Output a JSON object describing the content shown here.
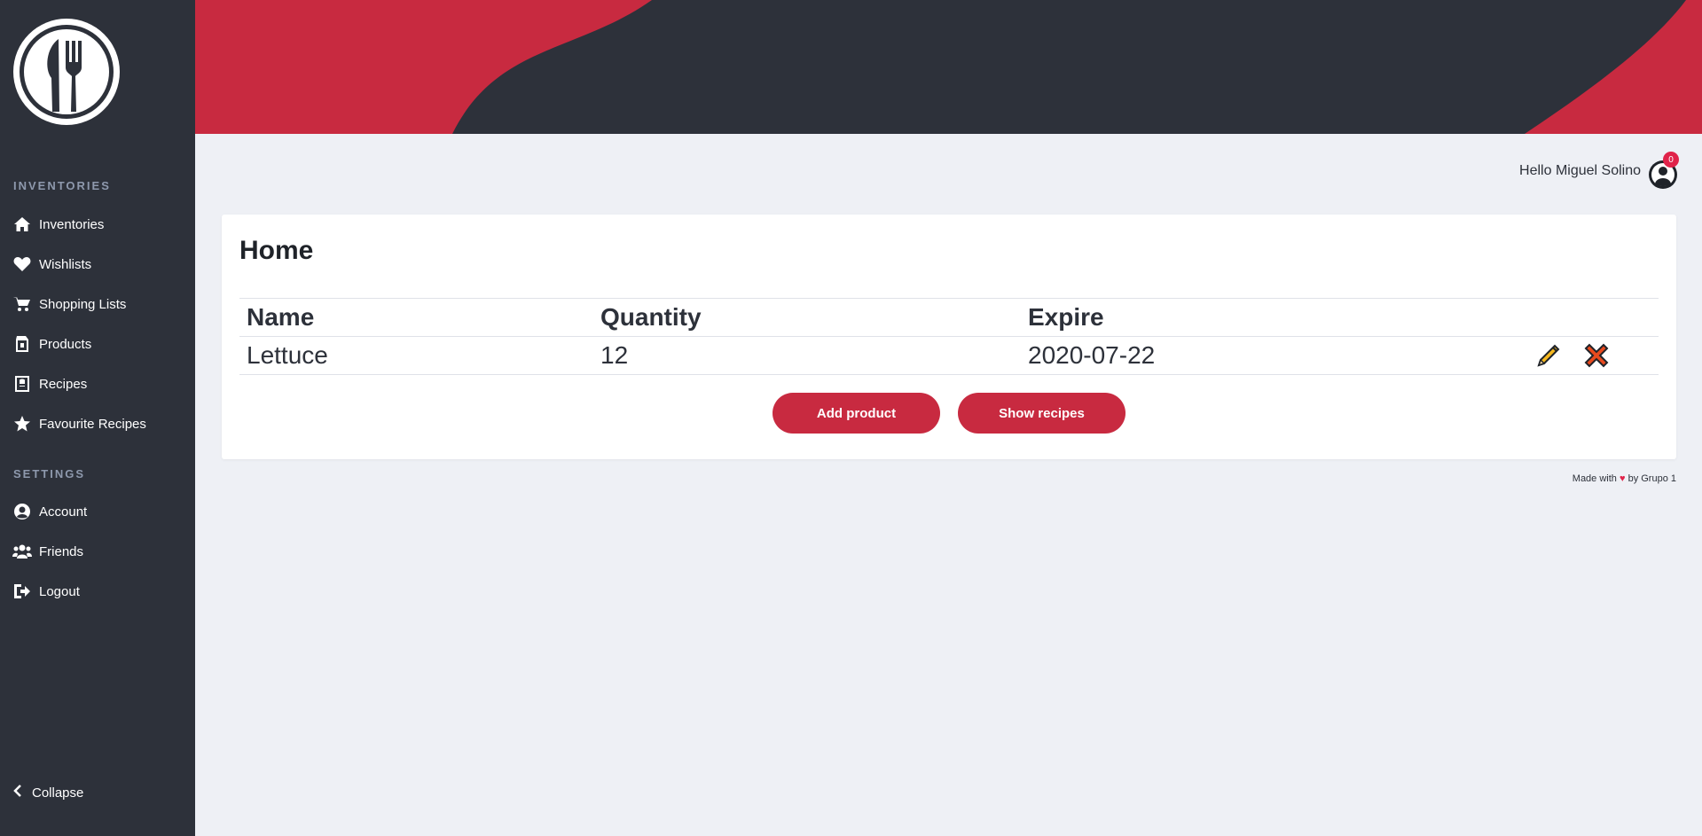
{
  "sidebar": {
    "sections": [
      {
        "title": "INVENTORIES"
      },
      {
        "title": "SETTINGS"
      }
    ],
    "items": [
      {
        "label": "Inventories",
        "icon": "home-icon"
      },
      {
        "label": "Wishlists",
        "icon": "heart-icon"
      },
      {
        "label": "Shopping Lists",
        "icon": "cart-icon"
      },
      {
        "label": "Products",
        "icon": "box-icon"
      },
      {
        "label": "Recipes",
        "icon": "recipe-book-icon"
      },
      {
        "label": "Favourite Recipes",
        "icon": "star-icon"
      },
      {
        "label": "Account",
        "icon": "user-circle-icon"
      },
      {
        "label": "Friends",
        "icon": "users-icon"
      },
      {
        "label": "Logout",
        "icon": "logout-icon"
      }
    ],
    "collapse_label": "Collapse"
  },
  "header": {
    "greeting": "Hello Miguel Solino",
    "notification_count": "0"
  },
  "main": {
    "title": "Home",
    "table": {
      "columns": [
        "Name",
        "Quantity",
        "Expire"
      ],
      "rows": [
        {
          "name": "Lettuce",
          "quantity": "12",
          "expire": "2020-07-22"
        }
      ]
    },
    "buttons": {
      "add_product": "Add product",
      "show_recipes": "Show recipes"
    }
  },
  "footer": {
    "prefix": "Made with",
    "suffix": "by Grupo 1"
  },
  "colors": {
    "sidebar_bg": "#2d313a",
    "accent": "#c82a40",
    "page_bg": "#eef0f5"
  }
}
